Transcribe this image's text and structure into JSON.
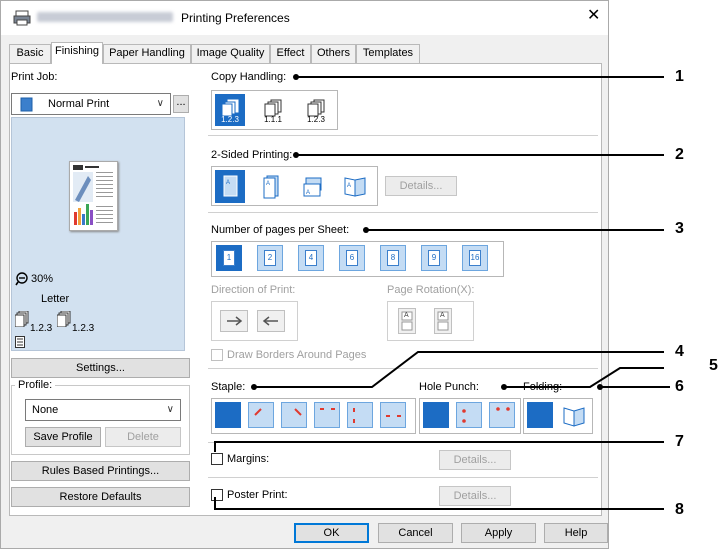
{
  "window": {
    "title": "Printing Preferences",
    "close": "✕"
  },
  "tabs": [
    "Basic",
    "Finishing",
    "Paper Handling",
    "Image Quality",
    "Effect",
    "Others",
    "Templates"
  ],
  "left": {
    "print_job_label": "Print Job:",
    "print_job_value": "Normal Print",
    "more_btn": "...",
    "zoom": "30%",
    "paper": "Letter",
    "copy_order_a": "1.2.3",
    "copy_order_b": "1.2.3",
    "settings_btn": "Settings...",
    "profile_label": "Profile:",
    "profile_value": "None",
    "save_profile_btn": "Save Profile",
    "delete_btn": "Delete",
    "rules_btn": "Rules Based Printings...",
    "restore_btn": "Restore Defaults"
  },
  "copy_handling": {
    "label": "Copy Handling:",
    "options": [
      "1.2.3",
      "1.1.1",
      "1.2.3"
    ]
  },
  "two_sided": {
    "label": "2-Sided Printing:",
    "details_btn": "Details..."
  },
  "pages_per_sheet": {
    "label": "Number of pages per Sheet:",
    "options": [
      "1",
      "2",
      "4",
      "6",
      "8",
      "9",
      "16"
    ]
  },
  "direction": {
    "label": "Direction of Print:"
  },
  "rotation": {
    "label": "Page Rotation(X):",
    "glyph_a": "A",
    "glyph_b": "A"
  },
  "draw_borders": {
    "label": "Draw Borders Around Pages"
  },
  "staple": {
    "label": "Staple:"
  },
  "hole_punch": {
    "label": "Hole Punch:"
  },
  "folding": {
    "label": "Folding:"
  },
  "margins": {
    "label": "Margins:",
    "details_btn": "Details..."
  },
  "poster": {
    "label": "Poster Print:",
    "details_btn": "Details..."
  },
  "footer": {
    "ok": "OK",
    "cancel": "Cancel",
    "apply": "Apply",
    "help": "Help"
  },
  "callouts": [
    "1",
    "2",
    "3",
    "4",
    "5",
    "6",
    "7",
    "8"
  ],
  "colors": {
    "accent": "#1c6cc4",
    "light_accent": "#c4dcf4",
    "preview_bg": "#d2e1f0"
  }
}
